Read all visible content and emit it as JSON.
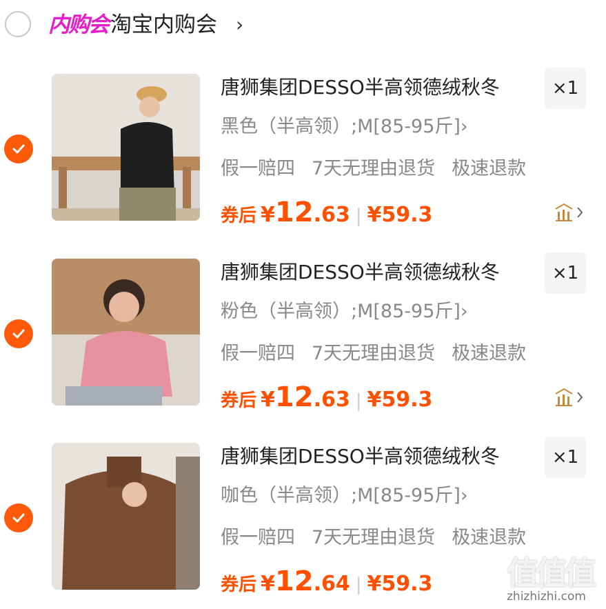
{
  "shop": {
    "badge": "内购会",
    "name": "淘宝内购会",
    "chevron": "›"
  },
  "items": [
    {
      "title": "唐狮集团DESSO半高领德绒秋冬",
      "qty": "×1",
      "sku": "黑色（半高领）;M[85-95斤]›",
      "tags": [
        "假一赔四",
        "7天无理由退货",
        "极速退款"
      ],
      "price_label": "券后",
      "price_currency": "¥",
      "price_int": "12",
      "price_dec": ".63",
      "orig_price": "¥59.3",
      "checked": true,
      "thumb_color": "#2a2a2a"
    },
    {
      "title": "唐狮集团DESSO半高领德绒秋冬",
      "qty": "×1",
      "sku": "粉色（半高领）;M[85-95斤]›",
      "tags": [
        "假一赔四",
        "7天无理由退货",
        "极速退款"
      ],
      "price_label": "券后",
      "price_currency": "¥",
      "price_int": "12",
      "price_dec": ".63",
      "orig_price": "¥59.3",
      "checked": true,
      "thumb_color": "#e39aa6"
    },
    {
      "title": "唐狮集团DESSO半高领德绒秋冬",
      "qty": "×1",
      "sku": "咖色（半高领）;M[85-95斤]›",
      "tags": [
        "假一赔四",
        "7天无理由退货",
        "极速退款"
      ],
      "price_label": "券后",
      "price_currency": "¥",
      "price_int": "12",
      "price_dec": ".64",
      "orig_price": "¥59.3",
      "checked": true,
      "thumb_color": "#7b4e34"
    }
  ],
  "watermark": {
    "glyphs": "值值值",
    "url": "zhizhizhi.com"
  },
  "colors": {
    "accent": "#ff5000",
    "check": "#ff5a0a",
    "badge": "#e61ec8"
  },
  "icons": {
    "radio": "unchecked-radio-icon",
    "check": "check-circle-icon",
    "trend": "price-trend-icon"
  }
}
